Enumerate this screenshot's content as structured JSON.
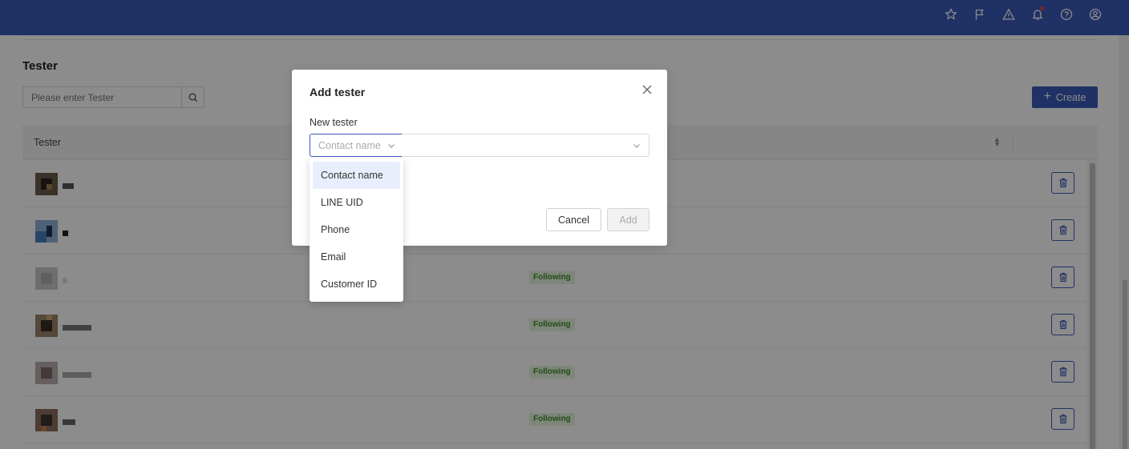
{
  "topbar": {
    "icons": [
      "star-icon",
      "flag-icon",
      "warning-icon",
      "bell-icon",
      "help-icon",
      "account-icon"
    ]
  },
  "page": {
    "title": "Tester",
    "search_placeholder": "Please enter Tester",
    "create_label": "Create",
    "table_header": "Tester"
  },
  "rows": [
    {
      "status": ""
    },
    {
      "status": ""
    },
    {
      "status": "Following"
    },
    {
      "status": "Following"
    },
    {
      "status": "Following"
    },
    {
      "status": "Following"
    }
  ],
  "modal": {
    "title": "Add tester",
    "field_label": "New tester",
    "type_placeholder": "Contact name",
    "cancel_label": "Cancel",
    "add_label": "Add"
  },
  "dropdown": {
    "selected": "Contact name",
    "options": [
      "Contact name",
      "LINE UID",
      "Phone",
      "Email",
      "Customer ID"
    ]
  },
  "colors": {
    "brand": "#3b5ab8",
    "status_green": "#3e8b2f"
  }
}
